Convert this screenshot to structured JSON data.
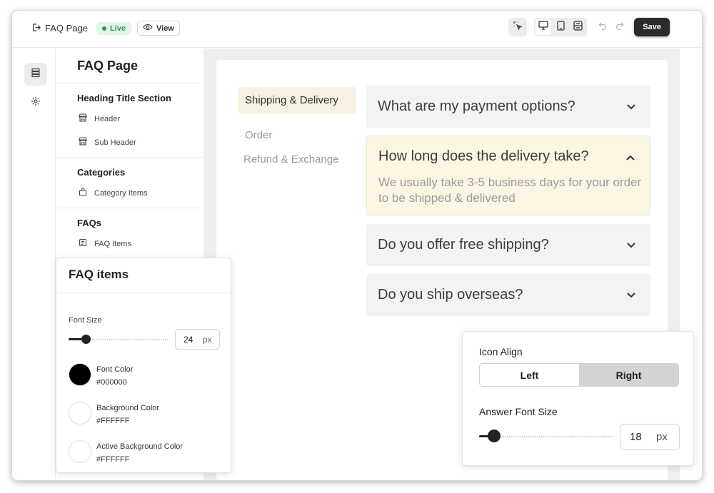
{
  "topbar": {
    "page_name": "FAQ Page",
    "status": "Live",
    "view_label": "View",
    "save_label": "Save"
  },
  "panel": {
    "title": "FAQ Page",
    "sections": [
      {
        "heading": "Heading Title Section",
        "items": [
          "Header",
          "Sub Header"
        ]
      },
      {
        "heading": "Categories",
        "items": [
          "Category Items"
        ]
      },
      {
        "heading": "FAQs",
        "items": [
          "FAQ Items"
        ]
      }
    ]
  },
  "categories": [
    "Shipping & Delivery",
    "Order",
    "Refund & Exchange"
  ],
  "faqs": [
    {
      "question": "What are my payment options?",
      "answer": ""
    },
    {
      "question": "How long does the delivery take?",
      "answer": "We usually take 3-5 business days for your order to be shipped & delivered"
    },
    {
      "question": "Do you offer free shipping?",
      "answer": ""
    },
    {
      "question": "Do you ship overseas?",
      "answer": ""
    }
  ],
  "faq_items_panel": {
    "title": "FAQ items",
    "font_size_label": "Font Size",
    "font_size_value": "24",
    "unit": "px",
    "font_size_slider_fraction": 0.17,
    "colors": [
      {
        "label": "Font Color",
        "hex": "#000000"
      },
      {
        "label": "Background Color",
        "hex": "#FFFFFF"
      },
      {
        "label": "Active Background Color",
        "hex": "#FFFFFF"
      }
    ]
  },
  "icon_align_panel": {
    "label": "Icon Align",
    "options": [
      "Left",
      "Right"
    ],
    "selected": "Right",
    "answer_font_size_label": "Answer Font Size",
    "answer_font_size_value": "18",
    "unit": "px",
    "answer_font_size_slider_fraction": 0.11
  },
  "theme": {
    "live_green": "#2e9b4f",
    "active_category_bg": "#f6f1e1",
    "active_faq_bg": "#fbf6e3"
  }
}
